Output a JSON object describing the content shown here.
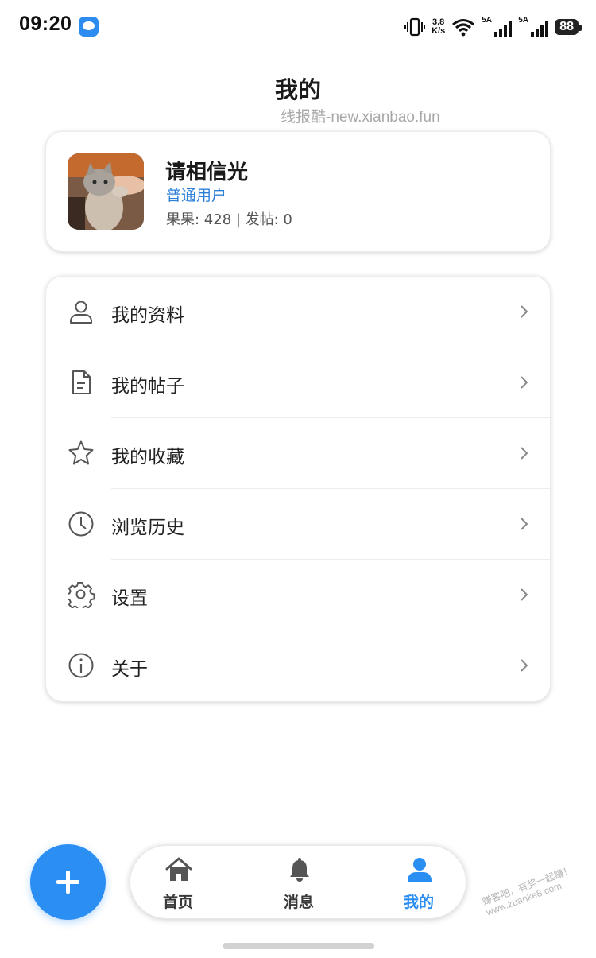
{
  "status_bar": {
    "time": "09:20",
    "net_speed_value": "3.8",
    "net_speed_unit": "K/s",
    "sim1_label": "5A",
    "sim2_label": "5A",
    "battery": "88",
    "icons": [
      "message-app-icon",
      "vibrate-icon",
      "wifi-icon",
      "signal-icon",
      "battery-icon"
    ]
  },
  "header": {
    "title": "我的",
    "watermark": "线报酷-new.xianbao.fun"
  },
  "profile": {
    "name": "请相信光",
    "level": "普通用户",
    "stats": "果果: 428 | 发帖: 0",
    "level_color": "#2b7fd9"
  },
  "menu": {
    "items": [
      {
        "label": "我的资料",
        "icon": "user-icon"
      },
      {
        "label": "我的帖子",
        "icon": "document-icon"
      },
      {
        "label": "我的收藏",
        "icon": "star-icon"
      },
      {
        "label": "浏览历史",
        "icon": "clock-icon"
      },
      {
        "label": "设置",
        "icon": "gear-icon"
      },
      {
        "label": "关于",
        "icon": "info-icon"
      }
    ]
  },
  "fab": {
    "icon": "plus-icon",
    "color": "#2a8ef3"
  },
  "bottom_nav": {
    "items": [
      {
        "label": "首页",
        "icon": "home-icon",
        "active": false
      },
      {
        "label": "消息",
        "icon": "bell-icon",
        "active": false
      },
      {
        "label": "我的",
        "icon": "person-icon",
        "active": true
      }
    ],
    "active_color": "#2a8ef3"
  },
  "corner_watermark": {
    "line1": "赚客吧，有奖一起赚！",
    "line2": "www.zuanke8.com"
  }
}
